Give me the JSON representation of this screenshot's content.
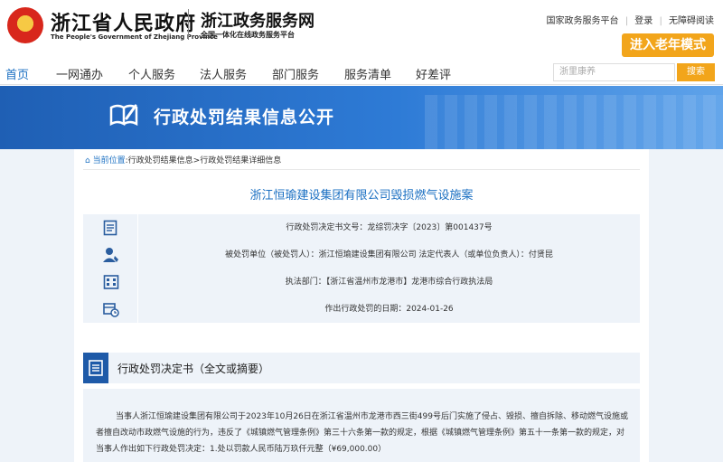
{
  "header": {
    "gov_title": "浙江省人民政府",
    "gov_subtitle": "The People's Government of Zhejiang Province",
    "service_title": "浙江政务服务网",
    "service_subtitle": "全国一体化在线政务服务平台",
    "links": [
      "国家政务服务平台",
      "登录",
      "无障碍阅读"
    ],
    "elder_mode": "进入老年模式"
  },
  "nav": {
    "items": [
      "首页",
      "一网通办",
      "个人服务",
      "法人服务",
      "部门服务",
      "服务清单",
      "好差评"
    ],
    "active_index": 0,
    "search_placeholder": "浙里康养",
    "search_button": "搜索"
  },
  "banner": {
    "title": "行政处罚结果信息公开"
  },
  "breadcrumb": {
    "items": [
      "当前位置",
      "行政处罚结果信息",
      "行政处罚结果详细信息"
    ],
    "separators": [
      ":",
      ">"
    ]
  },
  "case": {
    "title": "浙江恒瑜建设集团有限公司毁损燃气设施案"
  },
  "info": {
    "doc_number": "行政处罚决定书文号：龙综罚决字〔2023〕第001437号",
    "party": "被处罚单位（被处罚人）：浙江恒瑜建设集团有限公司    法定代表人（或单位负责人）：付贤昆",
    "department": "执法部门：【浙江省温州市龙港市】龙港市综合行政执法局",
    "date": "作出行政处罚的日期：2024-01-26"
  },
  "decision": {
    "label": "行政处罚决定书（全文或摘要）",
    "text": "当事人浙江恒瑜建设集团有限公司于2023年10月26日在浙江省温州市龙港市西三街499号后门实施了侵占、毁损、擅自拆除、移动燃气设施或者擅自改动市政燃气设施的行为，违反了《城镇燃气管理条例》第三十六条第一款的规定，根据《城镇燃气管理条例》第五十一条第一款的规定，对当事人作出如下行政处罚决定：1.处以罚款人民币陆万玖仟元整（¥69,000.00）"
  },
  "colors": {
    "accent_blue": "#1a6fc2",
    "banner_blue": "#2e7bd6",
    "orange": "#f2a51b",
    "panel_bg": "#eef3f9"
  }
}
